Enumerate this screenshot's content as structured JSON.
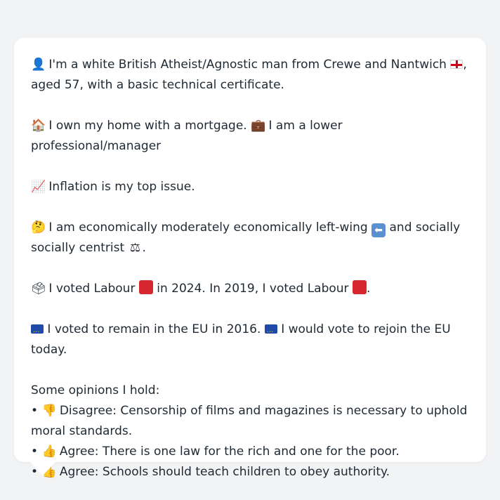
{
  "profile": {
    "line1": {
      "icon": "person-silhouette-icon",
      "text_a": "I'm a white British Atheist/Agnostic man from Crewe and Nantwich",
      "flag": "england-flag-icon",
      "text_b": ",",
      "text_c": "aged 57, with a basic technical certificate."
    },
    "line2": {
      "icon1": "house-icon",
      "text_a": "I own my home with a mortgage.",
      "icon2": "briefcase-icon",
      "text_b": "I am a lower professional/manager"
    },
    "line3": {
      "icon": "chart-increasing-icon",
      "text": "Inflation is my top issue."
    },
    "line4": {
      "icon": "thinking-face-icon",
      "text_a": "I am economically moderately economically left-wing",
      "icon2": "left-arrow-icon",
      "text_b": "and socially",
      "text_c": "socially centrist",
      "icon3": "balance-scale-icon",
      "text_d": "."
    },
    "line5": {
      "icon": "ballot-box-icon",
      "text_a": "I voted Labour",
      "icon2": "red-square-icon",
      "text_b": "in 2024. In 2019, I voted Labour",
      "icon3": "red-square-icon",
      "text_c": "."
    },
    "line6": {
      "icon": "eu-flag-icon",
      "text_a": "I voted to remain in the EU in 2016.",
      "icon2": "eu-flag-icon",
      "text_b": "I would vote to rejoin the EU today."
    },
    "opinions": {
      "heading": "Some opinions I hold:",
      "items": [
        {
          "bullet": "•",
          "icon": "thumbs-down-icon",
          "text_a": "Disagree: Censorship of films and magazines is necessary to uphold",
          "text_b": "moral standards."
        },
        {
          "bullet": "•",
          "icon": "thumbs-up-icon",
          "text_a": "Agree: There is one law for the rich and one for the poor."
        },
        {
          "bullet": "•",
          "icon": "thumbs-up-icon",
          "text_a": "Agree: Schools should teach children to obey authority."
        }
      ]
    }
  },
  "colors": {
    "background": "#f2f3f5",
    "card": "#ffffff",
    "text": "#1f2933",
    "labour_red": "#d7282f",
    "eu_blue": "#1f4aa8"
  }
}
